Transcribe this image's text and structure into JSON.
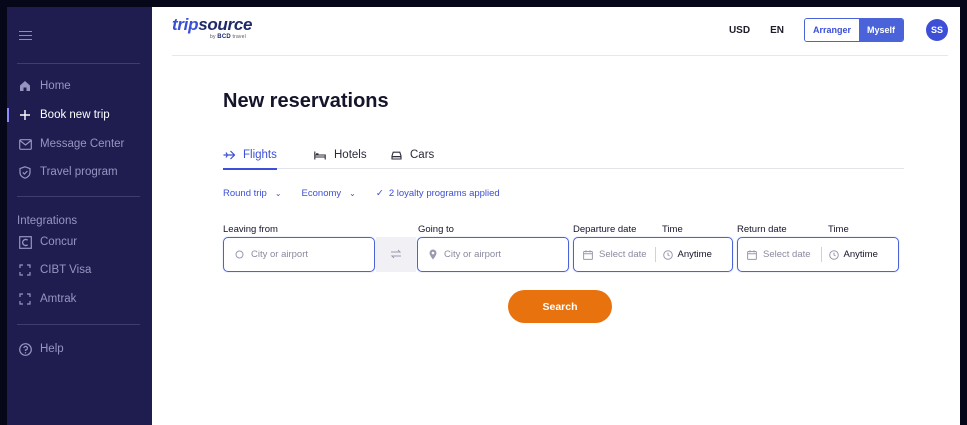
{
  "sidebar": {
    "nav": [
      {
        "label": "Home",
        "icon": "home-icon"
      },
      {
        "label": "Book new trip",
        "icon": "plus-icon"
      },
      {
        "label": "Message Center",
        "icon": "mail-icon"
      },
      {
        "label": "Travel program",
        "icon": "shield-icon"
      }
    ],
    "integrations_heading": "Integrations",
    "integrations": [
      {
        "label": "Concur",
        "icon": "concur-icon"
      },
      {
        "label": "CIBT Visa",
        "icon": "external-app-icon"
      },
      {
        "label": "Amtrak",
        "icon": "external-app-icon"
      }
    ],
    "help": {
      "label": "Help",
      "icon": "help-icon"
    }
  },
  "header": {
    "logo": {
      "main_prefix": "trip",
      "main_suffix": "source",
      "sub_by": "by",
      "sub_brand": "BCD",
      "sub_travel": "travel"
    },
    "currency": "USD",
    "language": "EN",
    "mode_options": [
      "Arranger",
      "Myself"
    ],
    "selected_mode": "Myself",
    "avatar_initials": "SS"
  },
  "page": {
    "title": "New reservations",
    "tabs": [
      {
        "label": "Flights",
        "icon": "plane-icon"
      },
      {
        "label": "Hotels",
        "icon": "bed-icon"
      },
      {
        "label": "Cars",
        "icon": "car-icon"
      }
    ],
    "active_tab": "Flights",
    "trip_type": "Round trip",
    "cabin_class": "Economy",
    "loyalty": "2 loyalty programs applied"
  },
  "form": {
    "leaving_from": {
      "label": "Leaving from",
      "placeholder": "City or airport"
    },
    "going_to": {
      "label": "Going to",
      "placeholder": "City or airport"
    },
    "departure": {
      "date_label": "Departure date",
      "time_label": "Time",
      "date_placeholder": "Select date",
      "time_value": "Anytime"
    },
    "return": {
      "date_label": "Return date",
      "time_label": "Time",
      "date_placeholder": "Select date",
      "time_value": "Anytime"
    },
    "search_button": "Search"
  },
  "colors": {
    "sidebar_bg": "#1f1d4f",
    "accent": "#3d4fd6",
    "search_button": "#e8730e",
    "frame": "#06081a"
  }
}
